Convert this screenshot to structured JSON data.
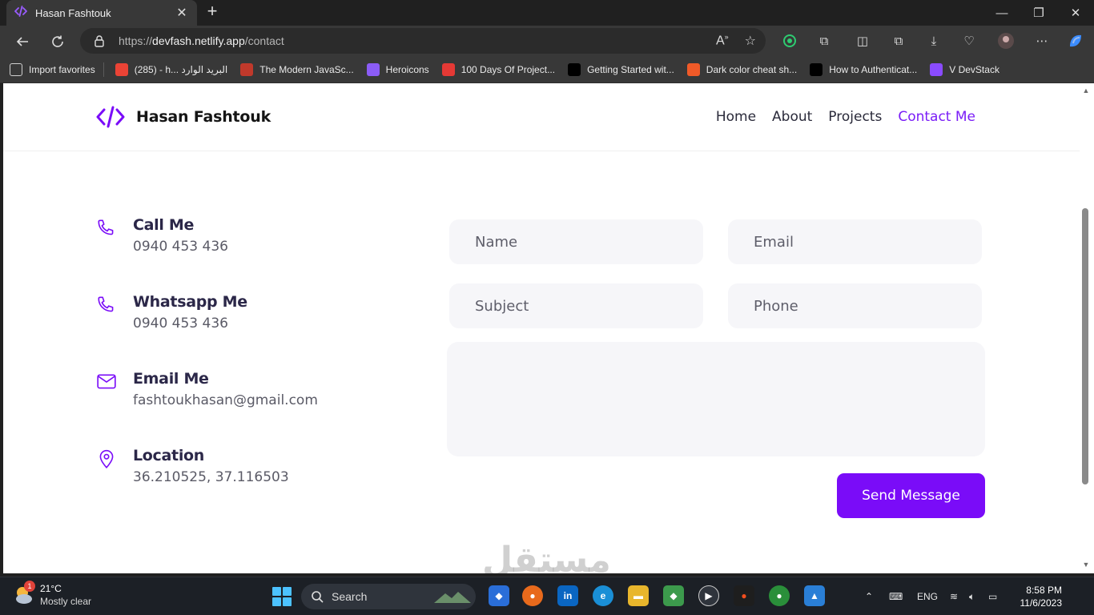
{
  "browser": {
    "tab_title": "Hasan Fashtouk",
    "tab_close": "✕",
    "new_tab": "+",
    "url_prefix": "https://",
    "url_host": "devfash.netlify.app",
    "url_path": "/contact",
    "favorites": [
      {
        "label": "Import favorites",
        "icon": "import-icon",
        "color": "#cfcfcf"
      },
      {
        "label": "(285) - h... البريد الوارد",
        "icon": "gmail-icon",
        "color": "#ea4335"
      },
      {
        "label": "The Modern JavaSc...",
        "icon": "js-icon",
        "color": "#c0392b"
      },
      {
        "label": "Heroicons",
        "icon": "heroicons-icon",
        "color": "#8b5cf6"
      },
      {
        "label": "100 Days Of Project...",
        "icon": "c-icon",
        "color": "#e53935"
      },
      {
        "label": "Getting Started wit...",
        "icon": "next-icon",
        "color": "#000000"
      },
      {
        "label": "Dark color cheat sh...",
        "icon": "sw-icon",
        "color": "#f05a28"
      },
      {
        "label": "How to Authenticat...",
        "icon": "medium-icon",
        "color": "#000000"
      },
      {
        "label": "V DevStack",
        "icon": "code-icon",
        "color": "#8a4bff"
      }
    ]
  },
  "site": {
    "brand": "Hasan Fashtouk",
    "nav": [
      "Home",
      "About",
      "Projects",
      "Contact Me"
    ],
    "accent": "#7a0cf8",
    "contacts": [
      {
        "title": "Call Me",
        "value": "0940 453 436",
        "icon": "phone-icon"
      },
      {
        "title": "Whatsapp Me",
        "value": "0940 453 436",
        "icon": "phone-icon"
      },
      {
        "title": "Email Me",
        "value": "fashtoukhasan@gmail.com",
        "icon": "mail-icon"
      },
      {
        "title": "Location",
        "value": "36.210525, 37.116503",
        "icon": "location-icon"
      }
    ],
    "form": {
      "name_placeholder": "Name",
      "email_placeholder": "Email",
      "subject_placeholder": "Subject",
      "phone_placeholder": "Phone",
      "message_placeholder": "",
      "submit": "Send Message"
    },
    "watermark": "مستقل"
  },
  "taskbar": {
    "weather_temp": "21°C",
    "weather_desc": "Mostly clear",
    "weather_badge": "1",
    "search": "Search",
    "language": "ENG",
    "time": "8:58 PM",
    "date": "11/6/2023"
  }
}
